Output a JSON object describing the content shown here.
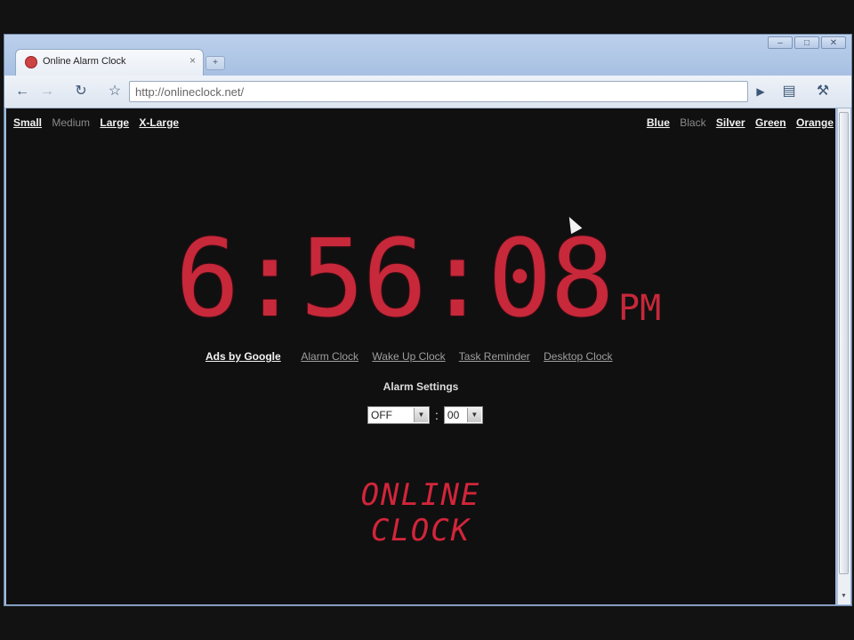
{
  "browser": {
    "tab_title": "Online Alarm Clock",
    "tab_close": "×",
    "new_tab": "+",
    "url": "http://onlineclock.net/",
    "win_min": "–",
    "win_max": "□",
    "win_close": "✕"
  },
  "page": {
    "sizes": [
      {
        "label": "Small",
        "active": false
      },
      {
        "label": "Medium",
        "active": true
      },
      {
        "label": "Large",
        "active": false
      },
      {
        "label": "X-Large",
        "active": false
      }
    ],
    "colors": [
      {
        "label": "Blue",
        "active": false
      },
      {
        "label": "Black",
        "active": true
      },
      {
        "label": "Silver",
        "active": false
      },
      {
        "label": "Green",
        "active": false
      },
      {
        "label": "Orange",
        "active": false
      }
    ],
    "clock": {
      "time": "6:56:08",
      "ampm": "PM"
    },
    "links": {
      "ads": "Ads by Google",
      "items": [
        "Alarm Clock",
        "Wake Up Clock",
        "Task Reminder",
        "Desktop Clock"
      ]
    },
    "alarm": {
      "title": "Alarm Settings",
      "hour_value": "OFF",
      "separator": ":",
      "minute_value": "00"
    },
    "logo_line1": "ONLINE",
    "logo_line2": "CLOCK"
  },
  "colors": {
    "clock_red": "#c7283a",
    "background": "#101010"
  }
}
